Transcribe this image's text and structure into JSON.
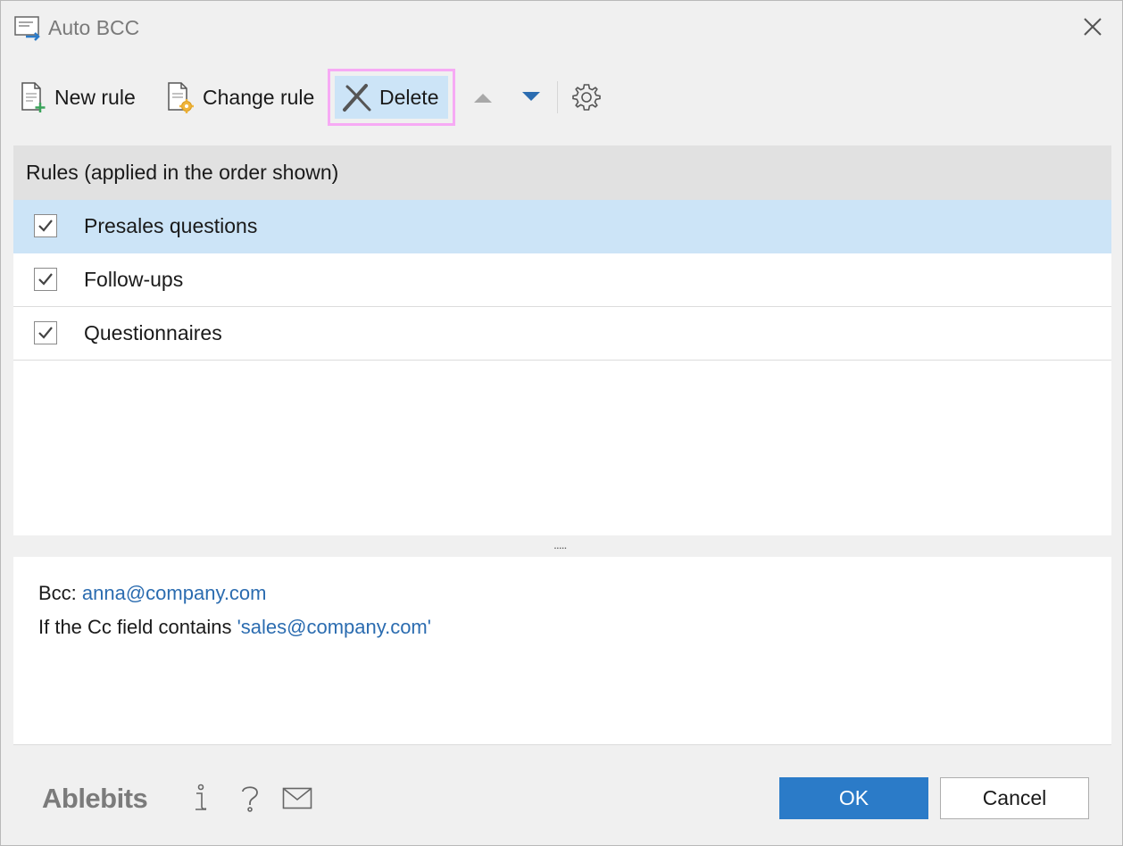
{
  "window": {
    "title": "Auto BCC",
    "icons": {
      "app": "auto-bcc-app-icon",
      "close": "close-icon"
    }
  },
  "toolbar": {
    "new_rule": {
      "label": "New rule",
      "icon": "new-document-plus-icon"
    },
    "change_rule": {
      "label": "Change rule",
      "icon": "document-gear-icon"
    },
    "delete": {
      "label": "Delete",
      "icon": "delete-x-icon",
      "highlighted": true
    },
    "move_up": {
      "icon": "triangle-up-icon"
    },
    "move_down": {
      "icon": "triangle-down-icon"
    },
    "settings": {
      "icon": "gear-icon"
    }
  },
  "rules": {
    "header": "Rules (applied in the order shown)",
    "items": [
      {
        "label": "Presales questions",
        "checked": true,
        "selected": true
      },
      {
        "label": "Follow-ups",
        "checked": true,
        "selected": false
      },
      {
        "label": "Questionnaires",
        "checked": true,
        "selected": false
      }
    ]
  },
  "splitter": {
    "grip": "....."
  },
  "details": {
    "bcc_prefix": "Bcc: ",
    "bcc_value": "anna@company.com",
    "condition_prefix": "If the Cc field contains ",
    "condition_value": "'sales@company.com'"
  },
  "footer": {
    "brand": "Ablebits",
    "icons": [
      "info-icon",
      "help-icon",
      "mail-icon"
    ],
    "ok_label": "OK",
    "cancel_label": "Cancel"
  },
  "colors": {
    "accent": "#2b7bc8",
    "selection": "#cce4f7",
    "highlight_border": "#f7aaf5",
    "link": "#2b6cb0",
    "background": "#f0f0f0"
  }
}
